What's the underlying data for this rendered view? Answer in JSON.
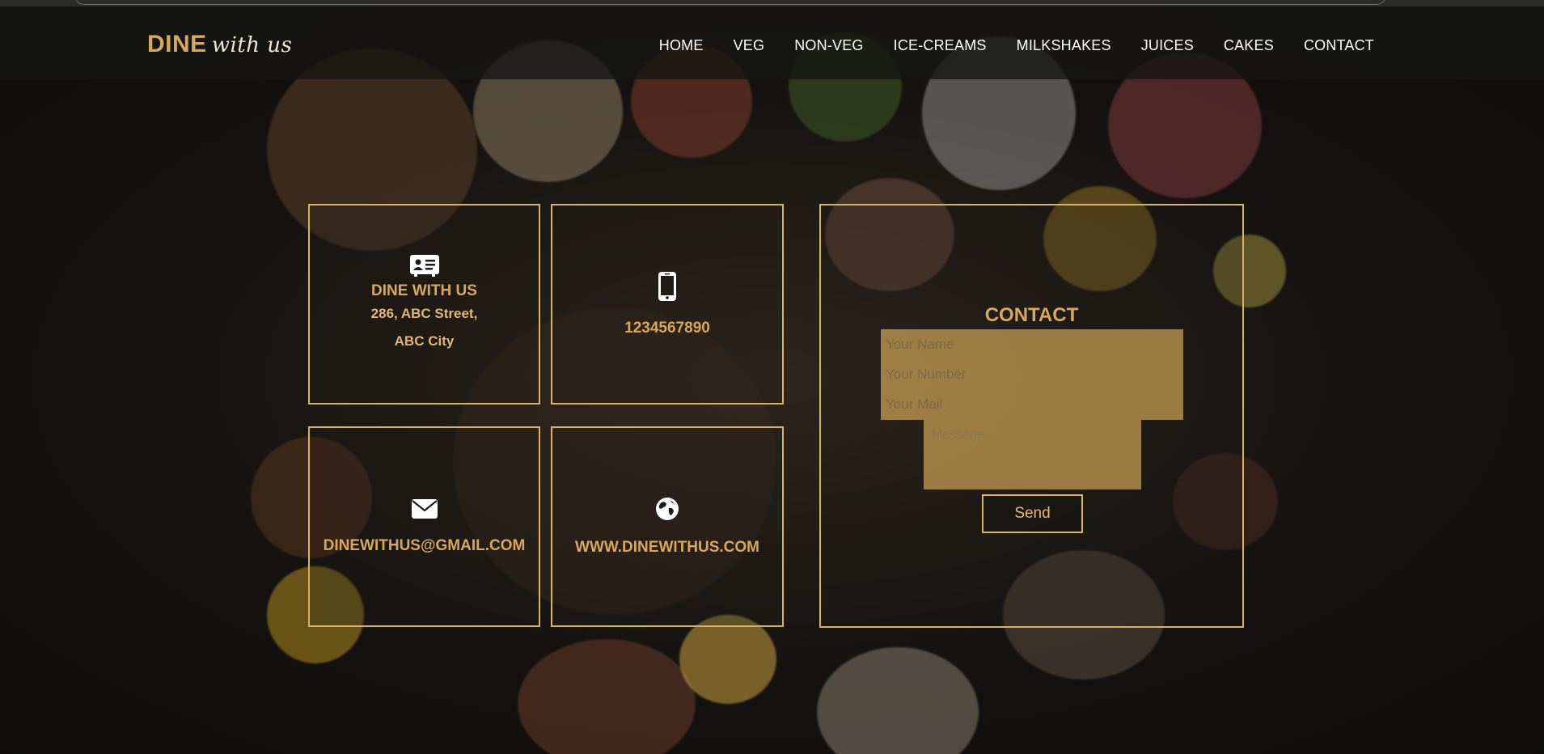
{
  "brand": {
    "bold": "DINE",
    "script": "with us"
  },
  "nav": {
    "items": [
      "HOME",
      "VEG",
      "NON-VEG",
      "ICE-CREAMS",
      "MILKSHAKES",
      "JUICES",
      "CAKES",
      "CONTACT"
    ]
  },
  "cards": {
    "address": {
      "icon": "contact-card-icon",
      "title": "DINE WITH US",
      "line1": "286, ABC Street,",
      "line2": "ABC City"
    },
    "phone": {
      "icon": "phone-icon",
      "value": "1234567890"
    },
    "email": {
      "icon": "envelope-icon",
      "value": "DINEWITHUS@GMAIL.COM"
    },
    "website": {
      "icon": "globe-icon",
      "value": "WWW.DINEWITHUS.COM"
    }
  },
  "contact_form": {
    "title": "CONTACT",
    "name_placeholder": "Your Name",
    "number_placeholder": "Your Number",
    "mail_placeholder": "Your Mail",
    "message_placeholder": "Message",
    "send_label": "Send"
  },
  "colors": {
    "accent": "#d9a75c",
    "border": "#d9b262",
    "field_fill": "#e8b860"
  }
}
